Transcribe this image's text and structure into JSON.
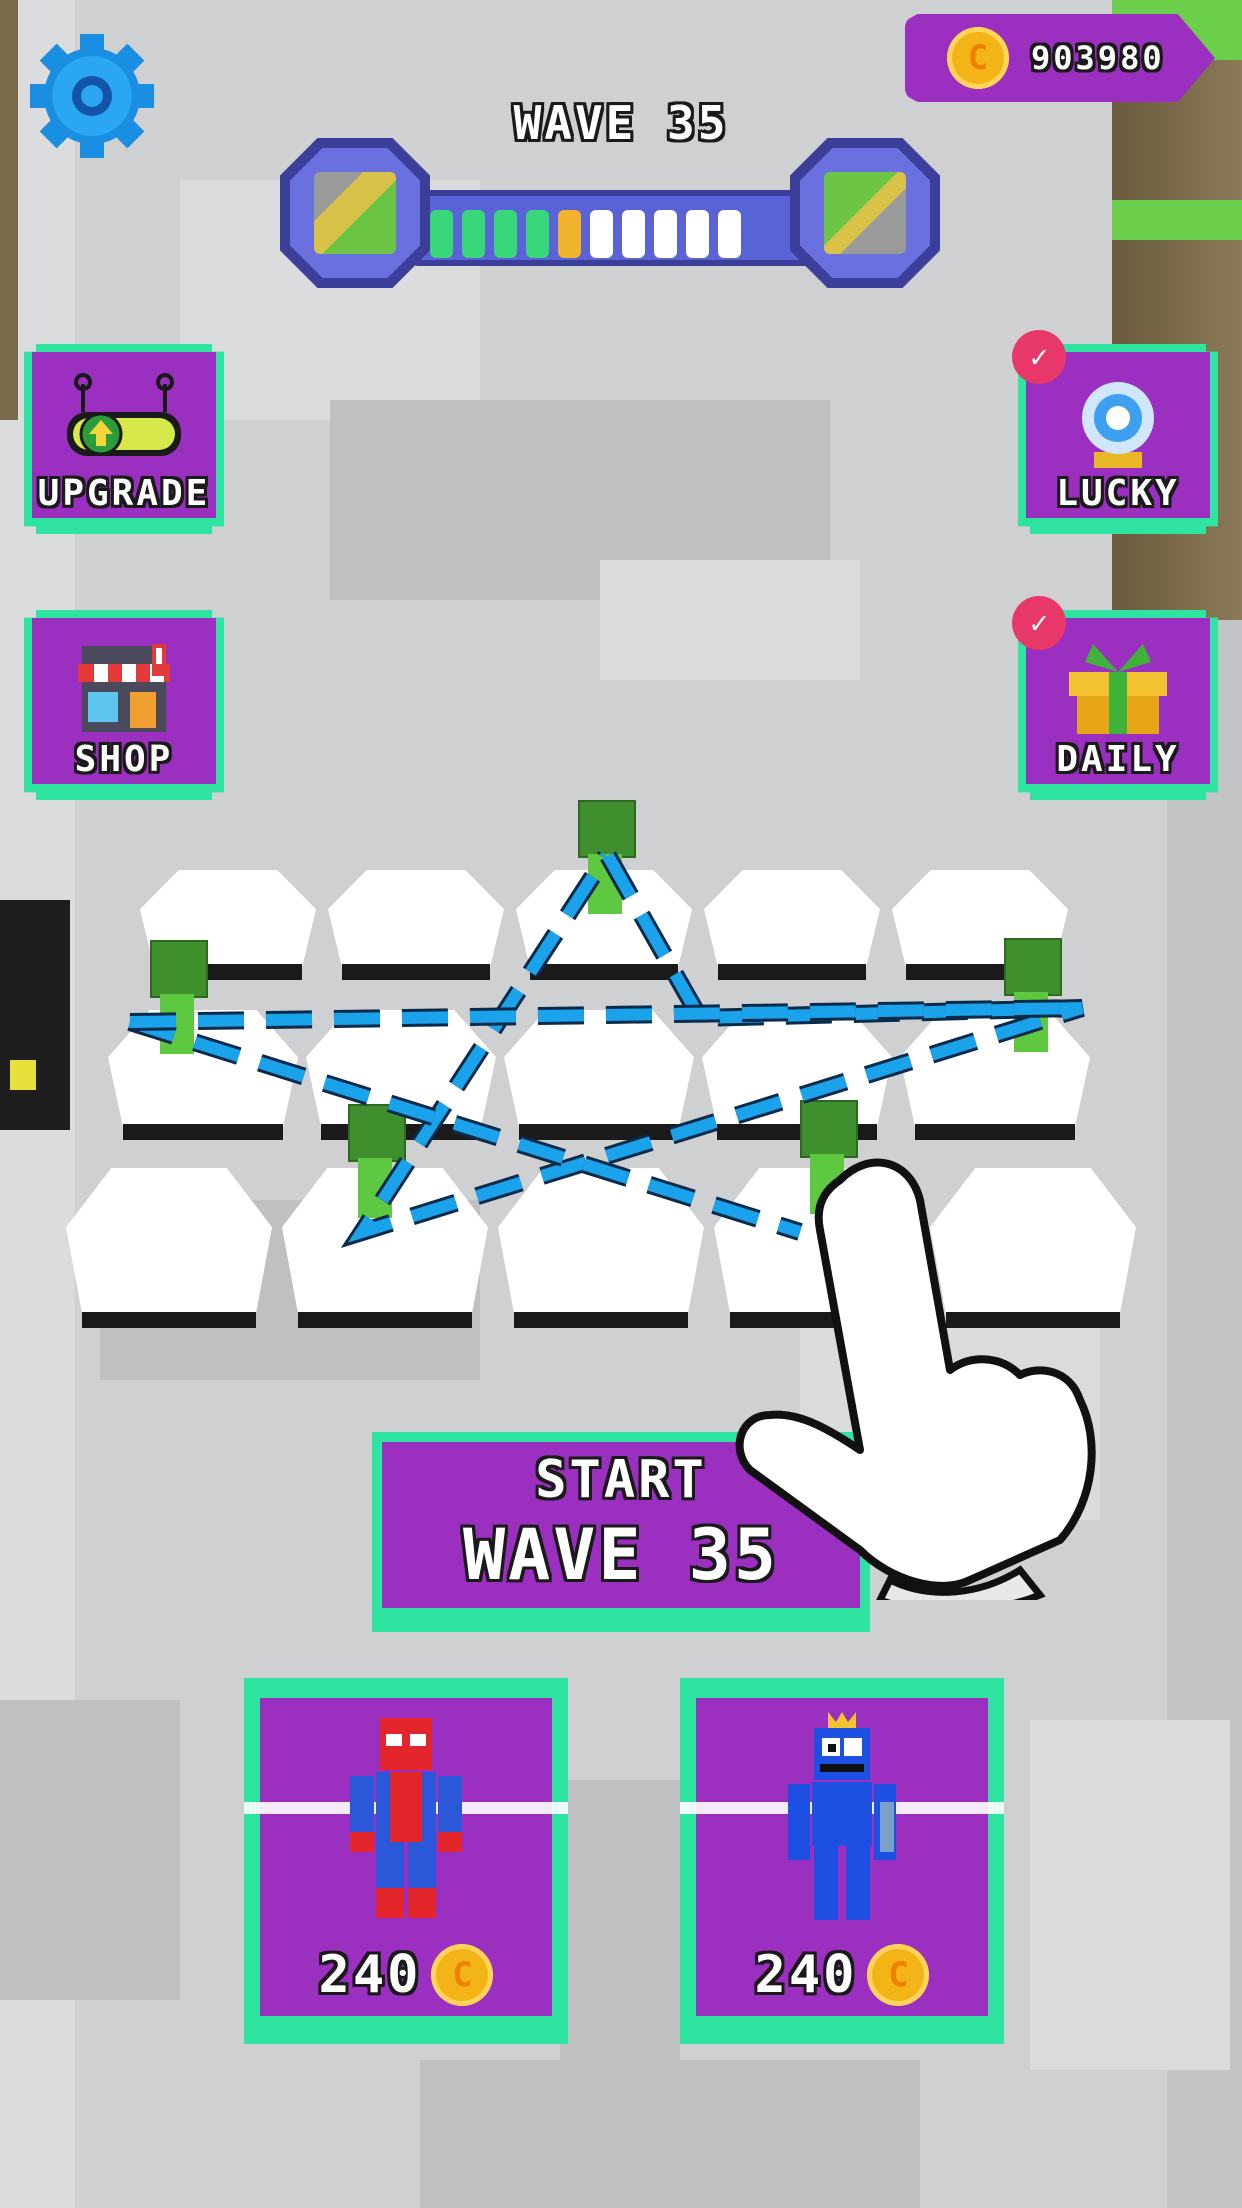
{
  "currency": {
    "icon": "coin-icon",
    "symbol": "C",
    "amount": "903980"
  },
  "wave": {
    "title": "WAVE 35",
    "progress_segments": [
      "done",
      "done",
      "done",
      "done",
      "current",
      "todo",
      "todo",
      "todo",
      "todo",
      "todo"
    ],
    "current_level_icon": "level-map-current-icon",
    "next_level_icon": "level-map-next-icon"
  },
  "side_buttons": {
    "upgrade": {
      "label": "UPGRADE",
      "icon": "battery-upgrade-icon"
    },
    "shop": {
      "label": "SHOP",
      "icon": "shop-icon"
    },
    "lucky": {
      "label": "LUCKY",
      "icon": "crystal-ball-icon",
      "badge": "✓"
    },
    "daily": {
      "label": "DAILY",
      "icon": "gift-icon",
      "badge": "✓"
    }
  },
  "start_button": {
    "line1": "START",
    "line2": "WAVE 35"
  },
  "shop_cards": [
    {
      "unit": "spider-hero",
      "price": "240",
      "coin_symbol": "C"
    },
    {
      "unit": "blue-monster",
      "price": "240",
      "coin_symbol": "C"
    }
  ],
  "colors": {
    "purple": "#9b2fc0",
    "mint": "#2fe3a0",
    "coin": "#f3b418",
    "path": "#1aa3ea"
  }
}
